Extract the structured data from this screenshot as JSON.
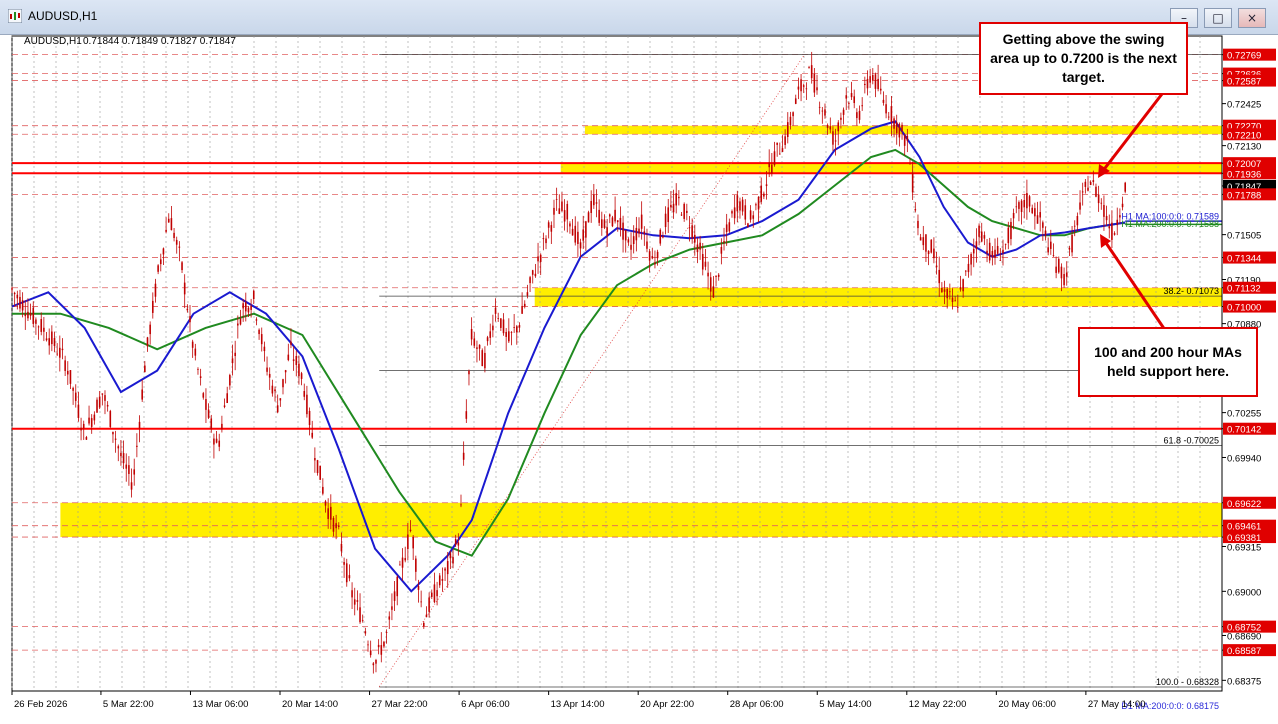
{
  "window": {
    "title": "AUDUSD,H1",
    "minimize_glyph": "–",
    "maximize_glyph": "□",
    "close_glyph": "×"
  },
  "chart_info": {
    "symbol_line": "AUDUSD,H1",
    "ohlc": "0.71844 0.71849 0.71827 0.71847"
  },
  "annotations": [
    {
      "text": "Getting above the swing area up to 0.7200 is the next target."
    },
    {
      "text": "100 and 200 hour MAs held support here."
    }
  ],
  "colors": {
    "candle": "#c00000",
    "ma100": "#1a1ad0",
    "ma200": "#208a20",
    "d1ma": "#2a2ad8",
    "zone": "#ffee00",
    "hline": "#ff0000",
    "price_label_red": "#e00000"
  },
  "chart_data": {
    "type": "candlestick",
    "y_range": [
      0.683,
      0.729
    ],
    "price_labels": [
      {
        "text": "0.72769",
        "value": 0.72769,
        "red": true
      },
      {
        "text": "0.72636",
        "value": 0.72636,
        "red": true
      },
      {
        "text": "0.72587",
        "value": 0.72587,
        "red": true
      },
      {
        "text": "0.72425",
        "value": 0.72425,
        "red": false
      },
      {
        "text": "0.72270",
        "value": 0.7227,
        "red": true
      },
      {
        "text": "0.72210",
        "value": 0.7221,
        "red": true
      },
      {
        "text": "0.72130",
        "value": 0.7213,
        "red": false
      },
      {
        "text": "0.72007",
        "value": 0.72007,
        "red": true
      },
      {
        "text": "0.71936",
        "value": 0.71936,
        "red": true
      },
      {
        "text": "0.71847",
        "value": 0.71847,
        "red": false,
        "current": true
      },
      {
        "text": "0.71788",
        "value": 0.71788,
        "red": true
      },
      {
        "text": "0.71505",
        "value": 0.71505,
        "red": false
      },
      {
        "text": "0.71344",
        "value": 0.71344,
        "red": true
      },
      {
        "text": "0.71190",
        "value": 0.7119,
        "red": false
      },
      {
        "text": "0.71132",
        "value": 0.71132,
        "red": true
      },
      {
        "text": "0.71000",
        "value": 0.71,
        "red": true
      },
      {
        "text": "0.70880",
        "value": 0.7088,
        "red": false
      },
      {
        "text": "0.70255",
        "value": 0.70255,
        "red": false
      },
      {
        "text": "0.70142",
        "value": 0.70142,
        "red": true
      },
      {
        "text": "0.69940",
        "value": 0.6994,
        "red": false
      },
      {
        "text": "0.69622",
        "value": 0.69622,
        "red": true
      },
      {
        "text": "0.69461",
        "value": 0.69461,
        "red": true
      },
      {
        "text": "0.69381",
        "value": 0.69381,
        "red": true
      },
      {
        "text": "0.69315",
        "value": 0.69315,
        "red": false
      },
      {
        "text": "0.69000",
        "value": 0.69,
        "red": false
      },
      {
        "text": "0.68752",
        "value": 0.68752,
        "red": true
      },
      {
        "text": "0.68690",
        "value": 0.6869,
        "red": false
      },
      {
        "text": "0.68587",
        "value": 0.68587,
        "red": true
      },
      {
        "text": "0.68375",
        "value": 0.68375,
        "red": false
      }
    ],
    "x_labels": [
      {
        "text": "26 Feb 2026",
        "pos": 0.0
      },
      {
        "text": "5 Mar 22:00",
        "pos": 0.0735
      },
      {
        "text": "13 Mar 06:00",
        "pos": 0.1475
      },
      {
        "text": "20 Mar 14:00",
        "pos": 0.2215
      },
      {
        "text": "27 Mar 22:00",
        "pos": 0.2955
      },
      {
        "text": "6 Apr 06:00",
        "pos": 0.3695
      },
      {
        "text": "13 Apr 14:00",
        "pos": 0.4435
      },
      {
        "text": "20 Apr 22:00",
        "pos": 0.5175
      },
      {
        "text": "28 Apr 06:00",
        "pos": 0.5915
      },
      {
        "text": "5 May 14:00",
        "pos": 0.6655
      },
      {
        "text": "12 May 22:00",
        "pos": 0.7395
      },
      {
        "text": "20 May 06:00",
        "pos": 0.8135
      },
      {
        "text": "27 May 14:00",
        "pos": 0.8875
      }
    ],
    "zones": [
      {
        "from": 0.69381,
        "to": 0.69622,
        "start": 0.04
      },
      {
        "from": 0.71,
        "to": 0.71132,
        "start": 0.432
      },
      {
        "from": 0.71936,
        "to": 0.72007,
        "start": 0.4535
      },
      {
        "from": 0.7221,
        "to": 0.7227,
        "start": 0.4735
      }
    ],
    "hlines": [
      {
        "value": 0.72007,
        "color": "red",
        "width": 2
      },
      {
        "value": 0.71936,
        "color": "red",
        "width": 2
      },
      {
        "value": 0.70142,
        "color": "red",
        "width": 2
      },
      {
        "value": 0.72769,
        "color": "dash"
      },
      {
        "value": 0.72636,
        "color": "dash"
      },
      {
        "value": 0.72587,
        "color": "dash"
      },
      {
        "value": 0.7227,
        "color": "dash"
      },
      {
        "value": 0.7221,
        "color": "dash"
      },
      {
        "value": 0.71788,
        "color": "dash"
      },
      {
        "value": 0.71344,
        "color": "dash"
      },
      {
        "value": 0.71132,
        "color": "dash"
      },
      {
        "value": 0.71,
        "color": "dash"
      },
      {
        "value": 0.69622,
        "color": "dash"
      },
      {
        "value": 0.69461,
        "color": "dash"
      },
      {
        "value": 0.69381,
        "color": "dash"
      },
      {
        "value": 0.68752,
        "color": "dash"
      },
      {
        "value": 0.68587,
        "color": "dash"
      }
    ],
    "fib_levels": [
      {
        "text": "",
        "value": 0.7277
      },
      {
        "text": "38.2- 0.71073",
        "value": 0.71073
      },
      {
        "text": "",
        "value": 0.7055
      },
      {
        "text": "61.8 -0.70025",
        "value": 0.70025
      },
      {
        "text": "100.0 - 0.68328",
        "value": 0.68328
      }
    ],
    "fib_start": 0.3035,
    "ma_labels": [
      {
        "text": "H1 MA:100:0:0: 0.71589",
        "value": 0.71589,
        "color": "ma100"
      },
      {
        "text": "H1 MA:200:0:0: 0.71588",
        "value": 0.71588,
        "color": "ma200"
      },
      {
        "text": "D1 MA:200:0:0: 0.68175",
        "value": 0.68175,
        "color": "d1ma"
      }
    ],
    "price_path": [
      [
        0.0,
        0.7112
      ],
      [
        0.015,
        0.7095
      ],
      [
        0.03,
        0.708
      ],
      [
        0.045,
        0.706
      ],
      [
        0.06,
        0.701
      ],
      [
        0.075,
        0.704
      ],
      [
        0.09,
        0.6995
      ],
      [
        0.1,
        0.6975
      ],
      [
        0.11,
        0.706
      ],
      [
        0.12,
        0.712
      ],
      [
        0.13,
        0.7165
      ],
      [
        0.14,
        0.713
      ],
      [
        0.15,
        0.707
      ],
      [
        0.16,
        0.703
      ],
      [
        0.17,
        0.7
      ],
      [
        0.18,
        0.705
      ],
      [
        0.19,
        0.71
      ],
      [
        0.2,
        0.7105
      ],
      [
        0.21,
        0.706
      ],
      [
        0.22,
        0.703
      ],
      [
        0.23,
        0.707
      ],
      [
        0.24,
        0.705
      ],
      [
        0.25,
        0.7
      ],
      [
        0.26,
        0.696
      ],
      [
        0.27,
        0.694
      ],
      [
        0.28,
        0.69
      ],
      [
        0.29,
        0.688
      ],
      [
        0.3,
        0.685
      ],
      [
        0.31,
        0.687
      ],
      [
        0.32,
        0.691
      ],
      [
        0.33,
        0.6945
      ],
      [
        0.34,
        0.688
      ],
      [
        0.35,
        0.69
      ],
      [
        0.36,
        0.6915
      ],
      [
        0.37,
        0.694
      ],
      [
        0.375,
        0.702
      ],
      [
        0.38,
        0.708
      ],
      [
        0.39,
        0.706
      ],
      [
        0.4,
        0.71
      ],
      [
        0.41,
        0.7075
      ],
      [
        0.42,
        0.709
      ],
      [
        0.43,
        0.712
      ],
      [
        0.44,
        0.7145
      ],
      [
        0.45,
        0.717
      ],
      [
        0.46,
        0.7165
      ],
      [
        0.47,
        0.714
      ],
      [
        0.48,
        0.7175
      ],
      [
        0.49,
        0.7155
      ],
      [
        0.5,
        0.7165
      ],
      [
        0.51,
        0.714
      ],
      [
        0.52,
        0.716
      ],
      [
        0.53,
        0.713
      ],
      [
        0.54,
        0.716
      ],
      [
        0.55,
        0.7175
      ],
      [
        0.56,
        0.716
      ],
      [
        0.57,
        0.7135
      ],
      [
        0.58,
        0.711
      ],
      [
        0.59,
        0.715
      ],
      [
        0.6,
        0.7175
      ],
      [
        0.61,
        0.716
      ],
      [
        0.62,
        0.718
      ],
      [
        0.63,
        0.7205
      ],
      [
        0.64,
        0.722
      ],
      [
        0.65,
        0.725
      ],
      [
        0.66,
        0.7265
      ],
      [
        0.67,
        0.724
      ],
      [
        0.68,
        0.7215
      ],
      [
        0.69,
        0.725
      ],
      [
        0.7,
        0.7235
      ],
      [
        0.71,
        0.7265
      ],
      [
        0.72,
        0.7245
      ],
      [
        0.73,
        0.723
      ],
      [
        0.74,
        0.7215
      ],
      [
        0.75,
        0.715
      ],
      [
        0.76,
        0.714
      ],
      [
        0.77,
        0.711
      ],
      [
        0.78,
        0.71
      ],
      [
        0.79,
        0.7125
      ],
      [
        0.8,
        0.7155
      ],
      [
        0.81,
        0.7135
      ],
      [
        0.82,
        0.714
      ],
      [
        0.83,
        0.7165
      ],
      [
        0.84,
        0.7175
      ],
      [
        0.85,
        0.716
      ],
      [
        0.86,
        0.7135
      ],
      [
        0.87,
        0.712
      ],
      [
        0.88,
        0.716
      ],
      [
        0.89,
        0.719
      ],
      [
        0.9,
        0.7175
      ],
      [
        0.91,
        0.715
      ],
      [
        0.92,
        0.7184
      ]
    ],
    "ma100_path": [
      [
        0.0,
        0.71
      ],
      [
        0.03,
        0.711
      ],
      [
        0.06,
        0.7085
      ],
      [
        0.09,
        0.704
      ],
      [
        0.12,
        0.7055
      ],
      [
        0.15,
        0.7095
      ],
      [
        0.18,
        0.711
      ],
      [
        0.21,
        0.7095
      ],
      [
        0.24,
        0.7065
      ],
      [
        0.27,
        0.7
      ],
      [
        0.3,
        0.693
      ],
      [
        0.33,
        0.69
      ],
      [
        0.36,
        0.6925
      ],
      [
        0.38,
        0.695
      ],
      [
        0.41,
        0.7025
      ],
      [
        0.44,
        0.7085
      ],
      [
        0.47,
        0.7135
      ],
      [
        0.5,
        0.7155
      ],
      [
        0.53,
        0.715
      ],
      [
        0.56,
        0.7148
      ],
      [
        0.59,
        0.715
      ],
      [
        0.62,
        0.716
      ],
      [
        0.65,
        0.7175
      ],
      [
        0.68,
        0.721
      ],
      [
        0.71,
        0.7225
      ],
      [
        0.73,
        0.723
      ],
      [
        0.75,
        0.7205
      ],
      [
        0.77,
        0.717
      ],
      [
        0.79,
        0.7145
      ],
      [
        0.81,
        0.7135
      ],
      [
        0.83,
        0.714
      ],
      [
        0.85,
        0.715
      ],
      [
        0.87,
        0.7152
      ],
      [
        0.89,
        0.7155
      ],
      [
        0.92,
        0.7159
      ]
    ],
    "ma200_path": [
      [
        0.0,
        0.7095
      ],
      [
        0.04,
        0.7095
      ],
      [
        0.08,
        0.7085
      ],
      [
        0.12,
        0.707
      ],
      [
        0.16,
        0.7085
      ],
      [
        0.2,
        0.7095
      ],
      [
        0.24,
        0.708
      ],
      [
        0.28,
        0.7025
      ],
      [
        0.32,
        0.697
      ],
      [
        0.35,
        0.6935
      ],
      [
        0.38,
        0.6925
      ],
      [
        0.41,
        0.6965
      ],
      [
        0.44,
        0.7025
      ],
      [
        0.47,
        0.708
      ],
      [
        0.5,
        0.7115
      ],
      [
        0.53,
        0.713
      ],
      [
        0.56,
        0.714
      ],
      [
        0.59,
        0.7145
      ],
      [
        0.62,
        0.715
      ],
      [
        0.65,
        0.7165
      ],
      [
        0.68,
        0.7185
      ],
      [
        0.71,
        0.7205
      ],
      [
        0.73,
        0.721
      ],
      [
        0.75,
        0.72
      ],
      [
        0.77,
        0.7185
      ],
      [
        0.79,
        0.717
      ],
      [
        0.81,
        0.716
      ],
      [
        0.83,
        0.7155
      ],
      [
        0.85,
        0.715
      ],
      [
        0.87,
        0.715
      ],
      [
        0.89,
        0.7155
      ],
      [
        0.92,
        0.7159
      ]
    ],
    "d1ma_path": [
      [
        0.3235,
        0.6828
      ],
      [
        0.55,
        0.696
      ],
      [
        0.72,
        0.7
      ],
      [
        0.92,
        0.709
      ]
    ],
    "trend_line": [
      [
        0.3035,
        0.6833
      ],
      [
        0.655,
        0.7277
      ]
    ]
  }
}
